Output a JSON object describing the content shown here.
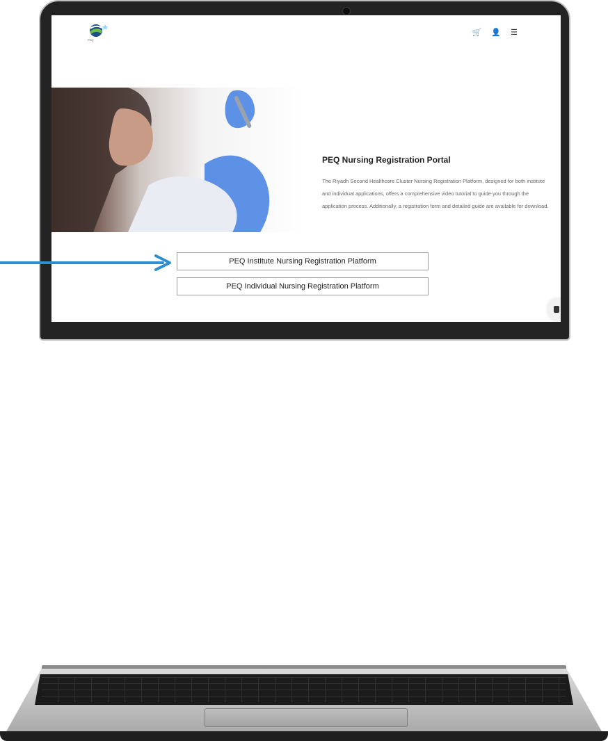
{
  "colors": {
    "arrow": "#2b8fd0",
    "laptop_frame": "#232323",
    "screen_bg": "#ffffff",
    "text_dark": "#222222",
    "text_muted": "#666666"
  },
  "logo": {
    "wordmark": "PEQ"
  },
  "header": {
    "icons": [
      "cart-icon",
      "user-icon",
      "menu-icon"
    ]
  },
  "hero": {
    "title": "PEQ Nursing Registration Portal",
    "description": "The Riyadh Second Healthcare Cluster Nursing Registration Platform, designed for both institute and individual applications, offers a comprehensive video tutorial to guide you through the application process. Additionally, a registration form and detailed guide are available for download."
  },
  "buttons": {
    "institute": "PEQ Institute Nursing Registration Platform",
    "individual": "PEQ Individual Nursing Registration Platform"
  }
}
